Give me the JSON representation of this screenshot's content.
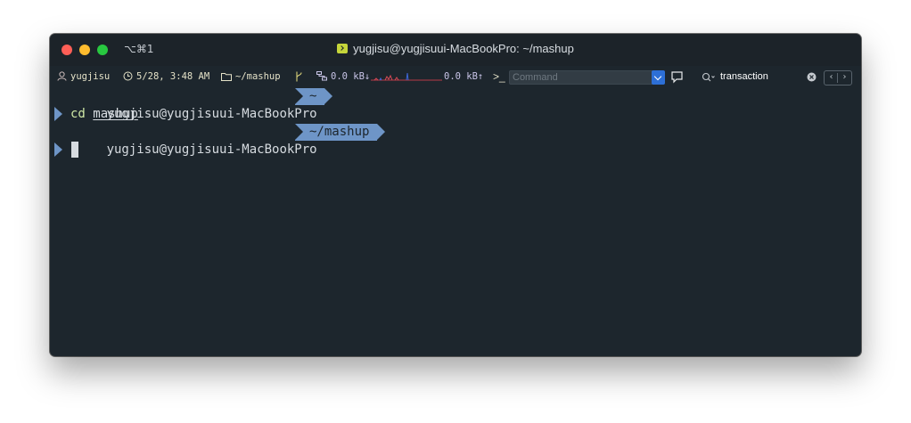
{
  "window": {
    "shortcut": "⌥⌘1",
    "title": "yugjisu@yugjisuui-MacBookPro: ~/mashup"
  },
  "statusbar": {
    "user": "yugjisu",
    "datetime": "5/28, 3:48 AM",
    "directory": "~/mashup",
    "net_down": "0.0 kB↓",
    "net_up": "0.0 kB↑",
    "command_placeholder": "Command",
    "search_query": "transaction",
    "icons": [
      "user-icon",
      "clock-icon",
      "folder-icon",
      "git-branch-icon",
      "network-icon",
      "prompt-icon",
      "chat-icon",
      "search-icon",
      "clear-icon",
      "chevron-left-icon",
      "chevron-right-icon"
    ]
  },
  "terminal": {
    "lines": [
      {
        "host": "yugjisu@yugjisuui-MacBookPro",
        "path": "~"
      },
      {
        "command": "cd",
        "argument": "mashup"
      },
      {
        "host": "yugjisu@yugjisuui-MacBookPro",
        "path": "~/mashup"
      }
    ]
  },
  "colors": {
    "background": "#1d262d",
    "prompt_segment": "#6e95c7",
    "command": "#cfe8a6",
    "text": "#d6dbe0",
    "accent_blue": "#2d6fd6"
  }
}
